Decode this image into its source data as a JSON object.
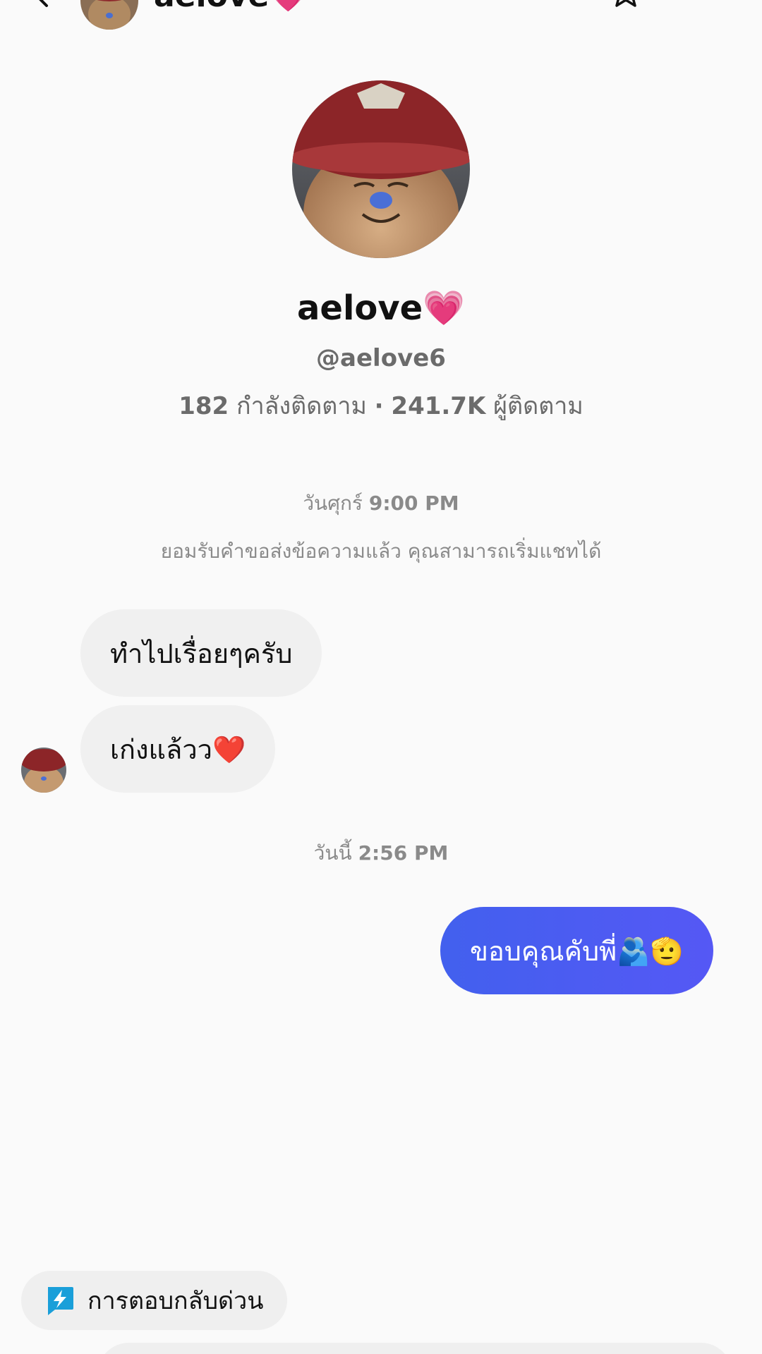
{
  "header": {
    "name": "aelove",
    "name_emoji": "💗"
  },
  "profile": {
    "display_name": "aelove",
    "display_emoji": "💗",
    "handle": "@aelove6",
    "following_count": "182",
    "following_label": "กำลังติดตาม",
    "separator": "·",
    "followers_count": "241.7K",
    "followers_label": "ผู้ติดตาม"
  },
  "chat": {
    "timestamp1_day": "วันศุกร์",
    "timestamp1_time": "9:00 PM",
    "system_message": "ยอมรับคำขอส่งข้อความแล้ว คุณสามารถเริ่มแชทได้",
    "messages": [
      {
        "text": "ทำไปเรื่อยๆครับ",
        "direction": "incoming"
      },
      {
        "text": "เก่งแล้วว❤️",
        "direction": "incoming"
      }
    ],
    "timestamp2_day": "วันนี้",
    "timestamp2_time": "2:56 PM",
    "outgoing": {
      "text": "ขอบคุณคับพี่🫂🫡",
      "direction": "outgoing"
    }
  },
  "quick_reply": {
    "label": "การตอบกลับด่วน",
    "icon": "lightning-bolt-icon"
  },
  "colors": {
    "outgoing_bubble": "#4a5cf0",
    "incoming_bubble": "#f0f0f0",
    "quick_reply_icon": "#1a9fd9"
  }
}
